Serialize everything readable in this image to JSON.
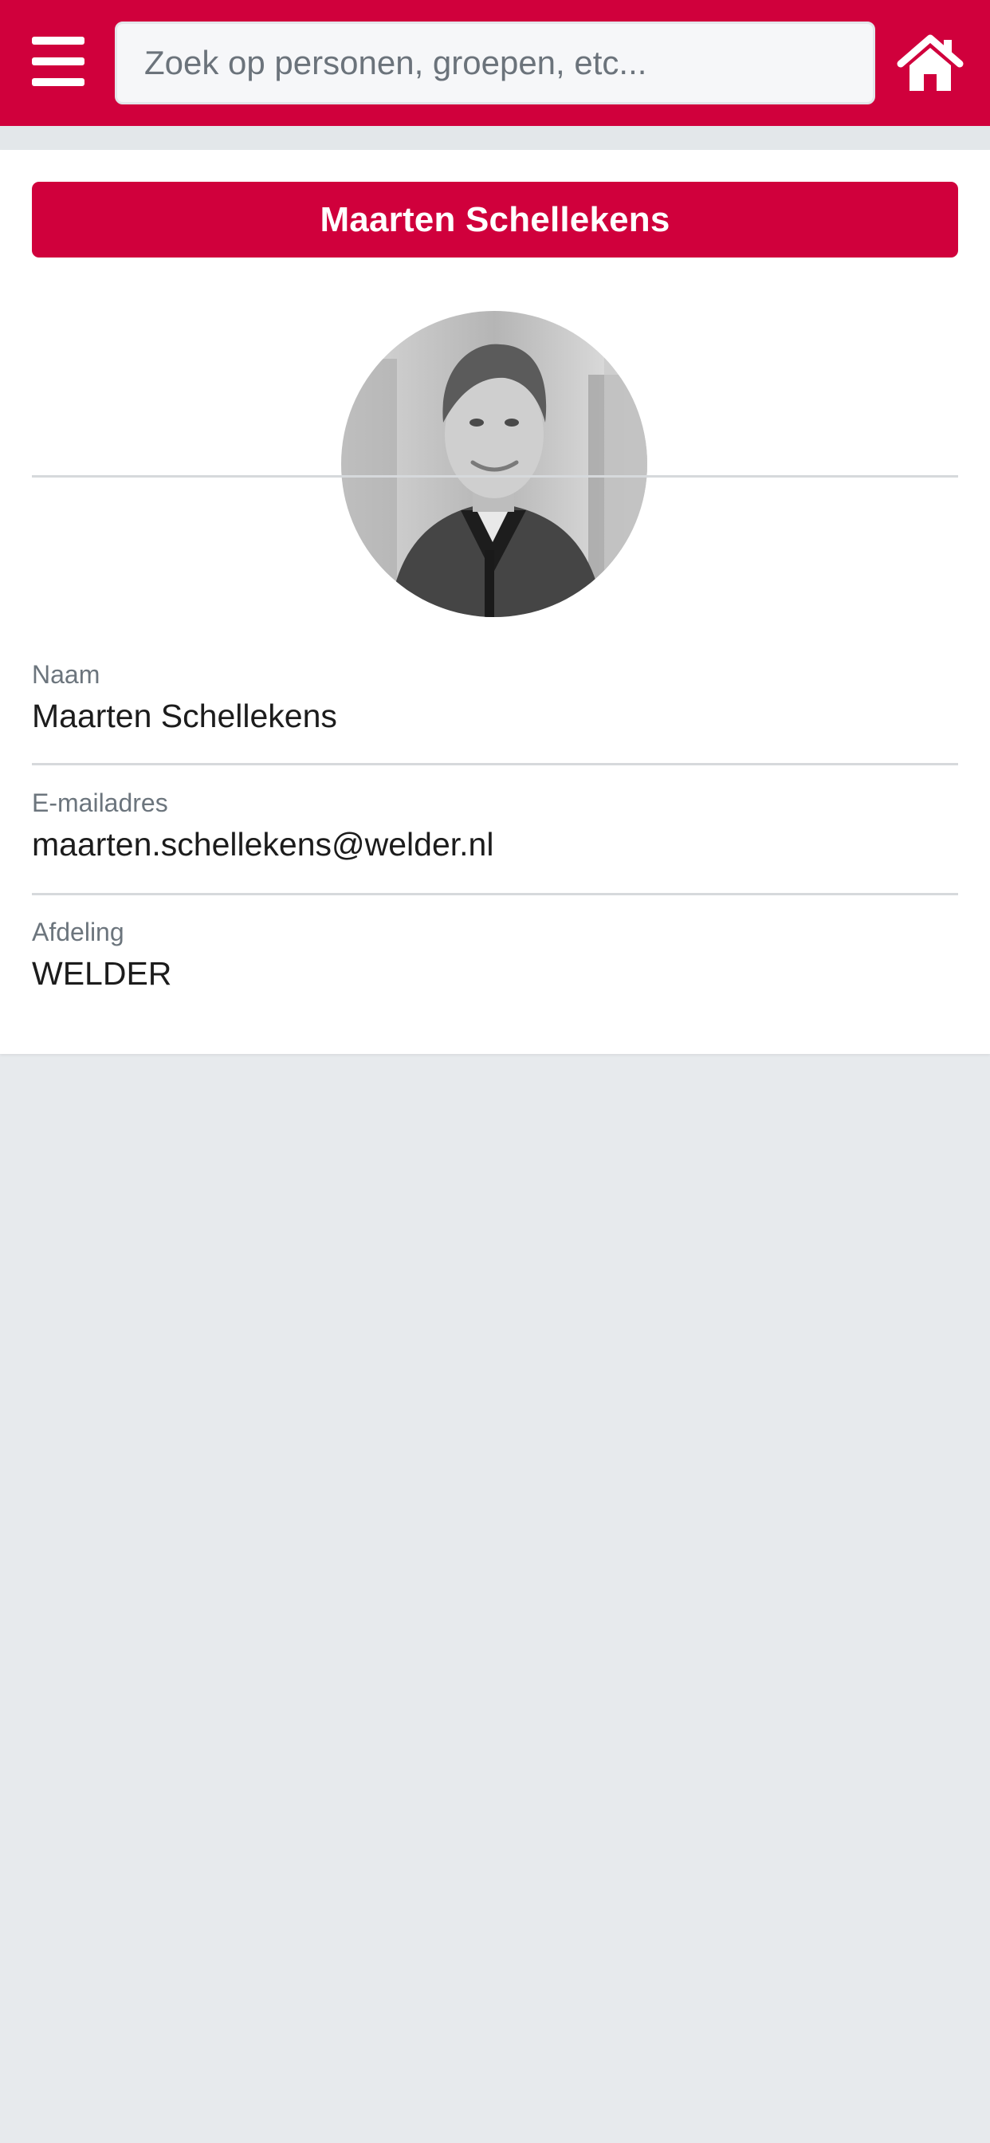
{
  "header": {
    "menu_icon": "hamburger-menu-icon",
    "search_placeholder": "Zoek op personen, groepen, etc...",
    "search_value": "",
    "home_icon": "home-icon",
    "brand_color": "#d0003c"
  },
  "profile": {
    "banner_name": "Maarten Schellekens",
    "avatar": "profile-photo",
    "fields": [
      {
        "label": "Naam",
        "value": "Maarten Schellekens"
      },
      {
        "label": "E-mailadres",
        "value": "maarten.schellekens@welder.nl"
      },
      {
        "label": "Afdeling",
        "value": "WELDER"
      }
    ]
  }
}
